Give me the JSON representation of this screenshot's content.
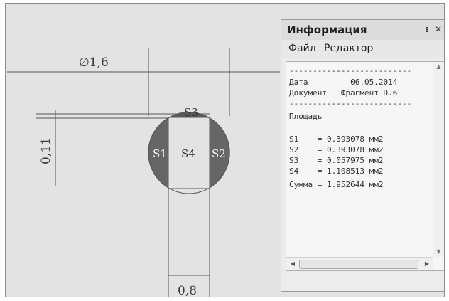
{
  "drawing": {
    "diameter_label": "∅1,6",
    "offset_label": "0,11",
    "width_label": "0,8",
    "region_labels": {
      "s1": "S1",
      "s2": "S2",
      "s3": "S3",
      "s4": "S4"
    },
    "colors": {
      "background": "#e3e3e3",
      "circle_fill": "#666666",
      "line": "#555555"
    }
  },
  "info_panel": {
    "title": "Информация",
    "pin_icon": "pin-icon",
    "close_icon": "close-icon",
    "menu": {
      "file": "Файл",
      "edit": "Редактор"
    },
    "lines": {
      "separator": "--------------------------",
      "date": "Дата         06.05.2014",
      "document": "Документ   Фрагмент D.6",
      "area_header": "Площадь",
      "s1": "S1    = 0.393078 мм2",
      "s2": "S2    = 0.393078 мм2",
      "s3": "S3    = 0.057975 мм2",
      "s4": "S4    = 1.108513 мм2",
      "sum": "Сумма = 1.952644 мм2"
    }
  }
}
